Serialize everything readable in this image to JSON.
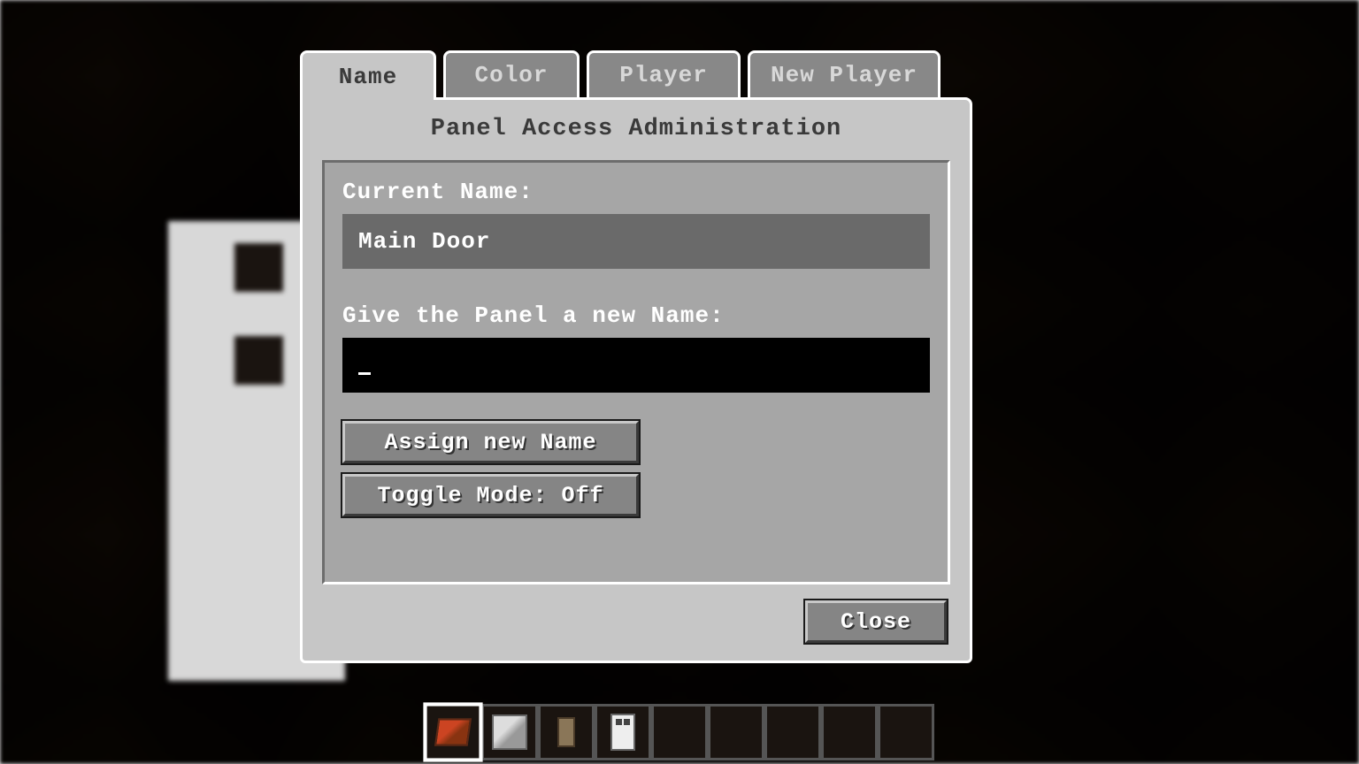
{
  "tabs": {
    "name": "Name",
    "color": "Color",
    "player": "Player",
    "new_player": "New Player"
  },
  "panel": {
    "title": "Panel Access Administration",
    "current_name_label": "Current Name:",
    "current_name_value": "Main Door",
    "new_name_label": "Give the Panel a new Name:",
    "new_name_value": "",
    "assign_button": "Assign new Name",
    "toggle_button": "Toggle Mode: Off",
    "close_button": "Close"
  },
  "hotbar": {
    "selected_index": 0,
    "slots": [
      {
        "item": "red-item"
      },
      {
        "item": "white-cube"
      },
      {
        "item": "panel-item"
      },
      {
        "item": "door-item"
      },
      {
        "item": null
      },
      {
        "item": null
      },
      {
        "item": null
      },
      {
        "item": null
      },
      {
        "item": null
      }
    ]
  }
}
